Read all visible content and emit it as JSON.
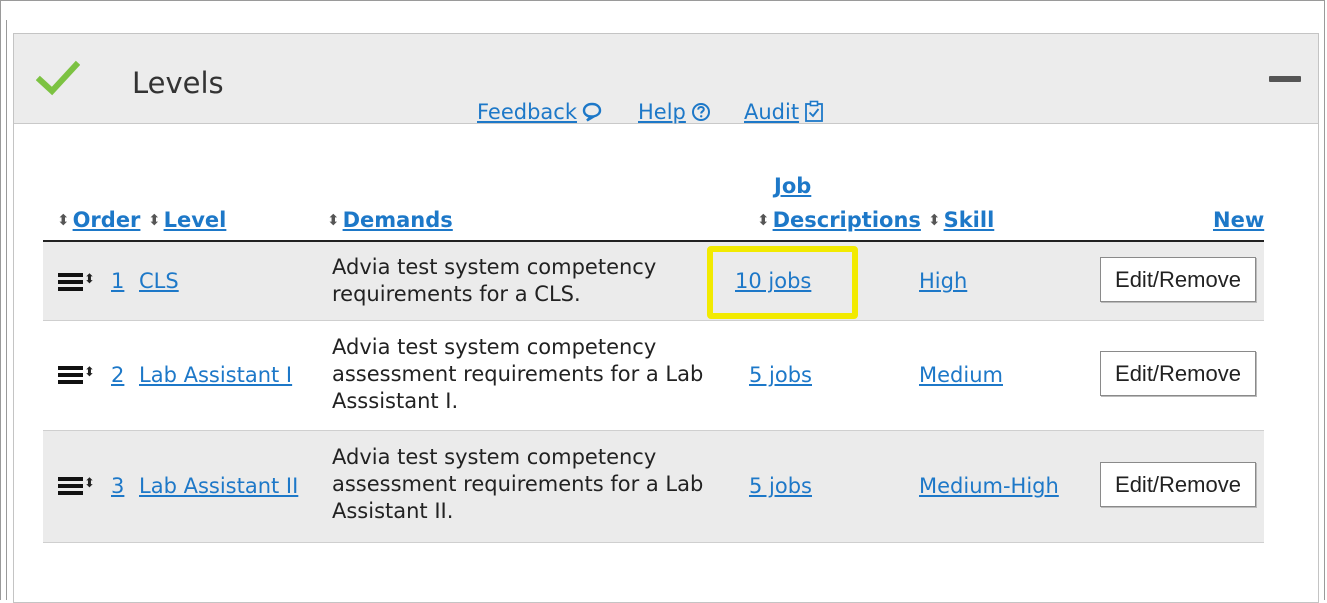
{
  "panel": {
    "title": "Levels",
    "status_icon": "check-icon",
    "collapse_icon": "minus-icon"
  },
  "top_links": {
    "feedback": "Feedback",
    "help": "Help",
    "audit": "Audit"
  },
  "columns": {
    "order": "Order",
    "level": "Level",
    "demands": "Demands",
    "job_descriptions_line1": "Job",
    "job_descriptions_line2": "Descriptions",
    "skill": "Skill",
    "new": "New"
  },
  "rows": [
    {
      "order": "1",
      "level": "CLS",
      "demands": [
        "Advia test system competency",
        "requirements for a CLS."
      ],
      "jobs": "10 jobs",
      "skill": "High",
      "action": "Edit/Remove"
    },
    {
      "order": "2",
      "level": "Lab Assistant I",
      "demands": [
        "Advia test system competency",
        "assessment requirements for a Lab",
        "Asssistant I."
      ],
      "jobs": "5 jobs",
      "skill": "Medium",
      "action": "Edit/Remove"
    },
    {
      "order": "3",
      "level": "Lab Assistant II",
      "demands": [
        "Advia test system competency",
        "assessment requirements for a Lab",
        "Assistant II."
      ],
      "jobs": "5 jobs",
      "skill": "Medium-High",
      "action": "Edit/Remove"
    }
  ],
  "colors": {
    "link": "#1d78c8",
    "check": "#7cc242",
    "highlight": "#f2ea00",
    "header_bg": "#ececec",
    "alt_row_bg": "#ebebeb"
  }
}
